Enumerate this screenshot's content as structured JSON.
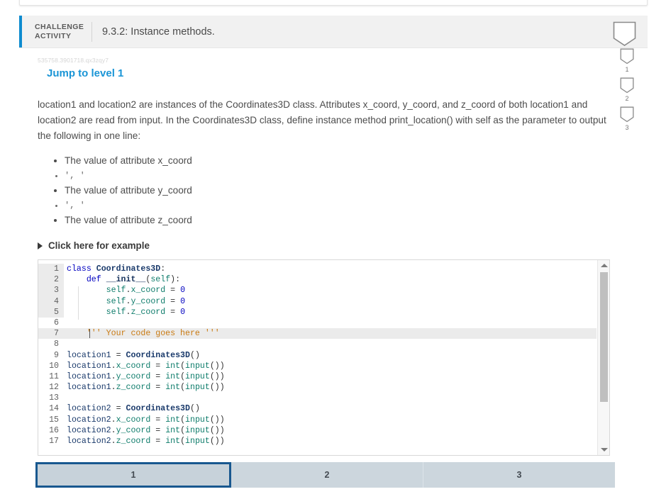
{
  "header": {
    "challenge_tag_line1": "CHALLENGE",
    "challenge_tag_line2": "ACTIVITY",
    "title": "9.3.2: Instance methods."
  },
  "body": {
    "activity_id": "535758.3901718.qx3zqy7",
    "jump_link": "Jump to level 1",
    "prompt": "location1 and location2 are instances of the Coordinates3D class. Attributes x_coord, y_coord, and z_coord of both location1 and location2 are read from input. In the Coordinates3D class, define instance method print_location() with self as the parameter to output the following in one line:",
    "spec_list": [
      "The value of attribute x_coord",
      "', '",
      "The value of attribute y_coord",
      "', '",
      "The value of attribute z_coord"
    ],
    "example_toggle": "Click here for example"
  },
  "editor": {
    "active_line": 7,
    "lines": [
      {
        "n": "1",
        "tokens": [
          {
            "t": "kw",
            "v": "class"
          },
          {
            "t": "plain",
            "v": " "
          },
          {
            "t": "cls",
            "v": "Coordinates3D"
          },
          {
            "t": "op",
            "v": ":"
          }
        ]
      },
      {
        "n": "2",
        "tokens": [
          {
            "t": "plain",
            "v": "    "
          },
          {
            "t": "kw",
            "v": "def"
          },
          {
            "t": "plain",
            "v": " "
          },
          {
            "t": "fn",
            "v": "__init__"
          },
          {
            "t": "op",
            "v": "("
          },
          {
            "t": "self",
            "v": "self"
          },
          {
            "t": "op",
            "v": "):"
          }
        ]
      },
      {
        "n": "3",
        "tokens": [
          {
            "t": "plain",
            "v": "        "
          },
          {
            "t": "self",
            "v": "self"
          },
          {
            "t": "op",
            "v": "."
          },
          {
            "t": "attr",
            "v": "x_coord"
          },
          {
            "t": "plain",
            "v": " "
          },
          {
            "t": "op",
            "v": "="
          },
          {
            "t": "plain",
            "v": " "
          },
          {
            "t": "num",
            "v": "0"
          }
        ]
      },
      {
        "n": "4",
        "tokens": [
          {
            "t": "plain",
            "v": "        "
          },
          {
            "t": "self",
            "v": "self"
          },
          {
            "t": "op",
            "v": "."
          },
          {
            "t": "attr",
            "v": "y_coord"
          },
          {
            "t": "plain",
            "v": " "
          },
          {
            "t": "op",
            "v": "="
          },
          {
            "t": "plain",
            "v": " "
          },
          {
            "t": "num",
            "v": "0"
          }
        ]
      },
      {
        "n": "5",
        "tokens": [
          {
            "t": "plain",
            "v": "        "
          },
          {
            "t": "self",
            "v": "self"
          },
          {
            "t": "op",
            "v": "."
          },
          {
            "t": "attr",
            "v": "z_coord"
          },
          {
            "t": "plain",
            "v": " "
          },
          {
            "t": "op",
            "v": "="
          },
          {
            "t": "plain",
            "v": " "
          },
          {
            "t": "num",
            "v": "0"
          }
        ]
      },
      {
        "n": "6",
        "tokens": []
      },
      {
        "n": "7",
        "tokens": [
          {
            "t": "plain",
            "v": "    "
          },
          {
            "t": "str",
            "v": "''' Your code goes here '''"
          }
        ]
      },
      {
        "n": "8",
        "tokens": []
      },
      {
        "n": "9",
        "tokens": [
          {
            "t": "var",
            "v": "location1"
          },
          {
            "t": "plain",
            "v": " "
          },
          {
            "t": "op",
            "v": "="
          },
          {
            "t": "plain",
            "v": " "
          },
          {
            "t": "cls",
            "v": "Coordinates3D"
          },
          {
            "t": "op",
            "v": "()"
          }
        ]
      },
      {
        "n": "10",
        "tokens": [
          {
            "t": "var",
            "v": "location1"
          },
          {
            "t": "op",
            "v": "."
          },
          {
            "t": "attr",
            "v": "x_coord"
          },
          {
            "t": "plain",
            "v": " "
          },
          {
            "t": "op",
            "v": "="
          },
          {
            "t": "plain",
            "v": " "
          },
          {
            "t": "builtin",
            "v": "int"
          },
          {
            "t": "op",
            "v": "("
          },
          {
            "t": "builtin",
            "v": "input"
          },
          {
            "t": "op",
            "v": "())"
          }
        ]
      },
      {
        "n": "11",
        "tokens": [
          {
            "t": "var",
            "v": "location1"
          },
          {
            "t": "op",
            "v": "."
          },
          {
            "t": "attr",
            "v": "y_coord"
          },
          {
            "t": "plain",
            "v": " "
          },
          {
            "t": "op",
            "v": "="
          },
          {
            "t": "plain",
            "v": " "
          },
          {
            "t": "builtin",
            "v": "int"
          },
          {
            "t": "op",
            "v": "("
          },
          {
            "t": "builtin",
            "v": "input"
          },
          {
            "t": "op",
            "v": "())"
          }
        ]
      },
      {
        "n": "12",
        "tokens": [
          {
            "t": "var",
            "v": "location1"
          },
          {
            "t": "op",
            "v": "."
          },
          {
            "t": "attr",
            "v": "z_coord"
          },
          {
            "t": "plain",
            "v": " "
          },
          {
            "t": "op",
            "v": "="
          },
          {
            "t": "plain",
            "v": " "
          },
          {
            "t": "builtin",
            "v": "int"
          },
          {
            "t": "op",
            "v": "("
          },
          {
            "t": "builtin",
            "v": "input"
          },
          {
            "t": "op",
            "v": "())"
          }
        ]
      },
      {
        "n": "13",
        "tokens": []
      },
      {
        "n": "14",
        "tokens": [
          {
            "t": "var",
            "v": "location2"
          },
          {
            "t": "plain",
            "v": " "
          },
          {
            "t": "op",
            "v": "="
          },
          {
            "t": "plain",
            "v": " "
          },
          {
            "t": "cls",
            "v": "Coordinates3D"
          },
          {
            "t": "op",
            "v": "()"
          }
        ]
      },
      {
        "n": "15",
        "tokens": [
          {
            "t": "var",
            "v": "location2"
          },
          {
            "t": "op",
            "v": "."
          },
          {
            "t": "attr",
            "v": "x_coord"
          },
          {
            "t": "plain",
            "v": " "
          },
          {
            "t": "op",
            "v": "="
          },
          {
            "t": "plain",
            "v": " "
          },
          {
            "t": "builtin",
            "v": "int"
          },
          {
            "t": "op",
            "v": "("
          },
          {
            "t": "builtin",
            "v": "input"
          },
          {
            "t": "op",
            "v": "())"
          }
        ]
      },
      {
        "n": "16",
        "tokens": [
          {
            "t": "var",
            "v": "location2"
          },
          {
            "t": "op",
            "v": "."
          },
          {
            "t": "attr",
            "v": "y_coord"
          },
          {
            "t": "plain",
            "v": " "
          },
          {
            "t": "op",
            "v": "="
          },
          {
            "t": "plain",
            "v": " "
          },
          {
            "t": "builtin",
            "v": "int"
          },
          {
            "t": "op",
            "v": "("
          },
          {
            "t": "builtin",
            "v": "input"
          },
          {
            "t": "op",
            "v": "())"
          }
        ]
      },
      {
        "n": "17",
        "tokens": [
          {
            "t": "var",
            "v": "location2"
          },
          {
            "t": "op",
            "v": "."
          },
          {
            "t": "attr",
            "v": "z_coord"
          },
          {
            "t": "plain",
            "v": " "
          },
          {
            "t": "op",
            "v": "="
          },
          {
            "t": "plain",
            "v": " "
          },
          {
            "t": "builtin",
            "v": "int"
          },
          {
            "t": "op",
            "v": "("
          },
          {
            "t": "builtin",
            "v": "input"
          },
          {
            "t": "op",
            "v": "())"
          }
        ]
      }
    ]
  },
  "shields": {
    "header_icon": "shield-icon",
    "rail": [
      {
        "num": "1",
        "icon": "shield-icon"
      },
      {
        "num": "2",
        "icon": "shield-icon"
      },
      {
        "num": "3",
        "icon": "shield-icon"
      }
    ]
  },
  "tabs": {
    "selected": "1",
    "items": [
      {
        "label": "1"
      },
      {
        "label": "2"
      },
      {
        "label": "3"
      }
    ]
  },
  "colors": {
    "accent_blue": "#0e8bcf",
    "link_blue": "#1a95d6",
    "tab_bg": "#ccd6dd",
    "tab_selected_border": "#18588f",
    "header_bg": "#f1f1f1"
  }
}
